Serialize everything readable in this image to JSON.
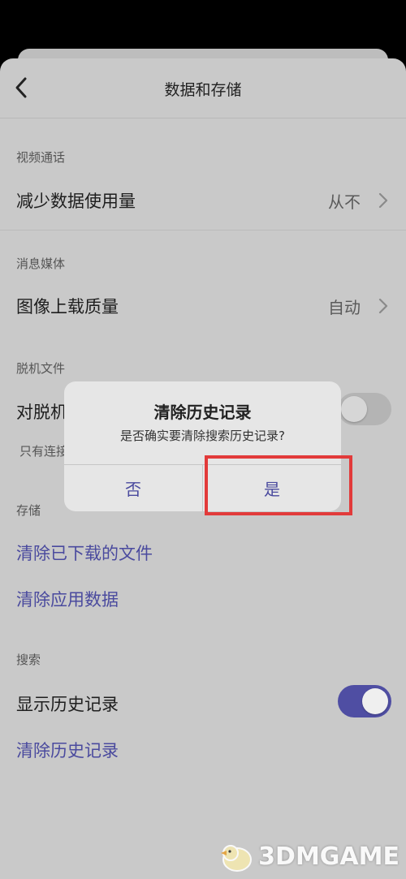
{
  "header": {
    "title": "数据和存储"
  },
  "video_call": {
    "section_label": "视频通话",
    "reduce_data_label": "减少数据使用量",
    "reduce_data_value": "从不"
  },
  "media": {
    "section_label": "消息媒体",
    "upload_quality_label": "图像上载质量",
    "upload_quality_value": "自动"
  },
  "offline": {
    "section_label": "脱机文件",
    "offline_label": "对脱机",
    "offline_toggle_on": false,
    "note": "只有连接"
  },
  "storage": {
    "section_label": "存储",
    "clear_downloads": "清除已下载的文件",
    "clear_app_data": "清除应用数据"
  },
  "search": {
    "section_label": "搜索",
    "show_history_label": "显示历史记录",
    "show_history_toggle_on": true,
    "clear_history": "清除历史记录"
  },
  "dialog": {
    "title": "清除历史记录",
    "message": "是否确实要清除搜索历史记录?",
    "no_label": "否",
    "yes_label": "是"
  },
  "watermark": {
    "text": "3DMGAME"
  },
  "colors": {
    "accent": "#4f4ea3",
    "highlight": "#e23a3a",
    "link": "#4a4a9e"
  }
}
